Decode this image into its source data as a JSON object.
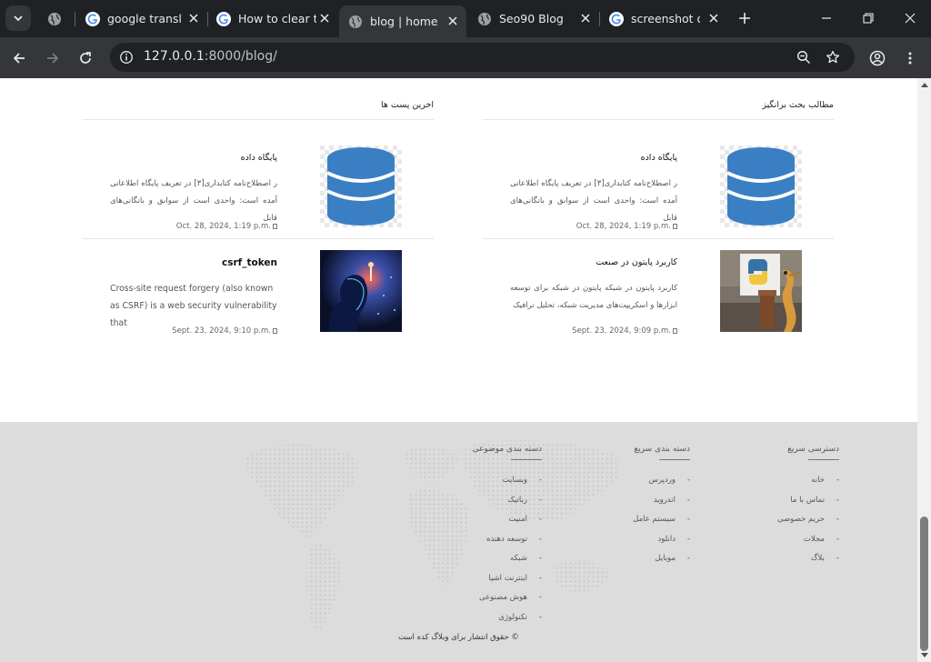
{
  "browser": {
    "tabs": [
      {
        "title": "",
        "favicon": "globe-icon"
      },
      {
        "title": "google transl",
        "favicon": "google-icon"
      },
      {
        "title": "How to clear t",
        "favicon": "google-icon"
      },
      {
        "title": "blog | home",
        "favicon": "globe-icon",
        "active": true
      },
      {
        "title": "Seo90 Blog",
        "favicon": "globe-icon"
      },
      {
        "title": "screenshot or",
        "favicon": "google-icon"
      }
    ],
    "url_host": "127.0.0.1",
    "url_rest": ":8000/blog/"
  },
  "page": {
    "right_column": {
      "title": "مطالب بحث برانگیز",
      "posts": [
        {
          "title": "پایگاه داده",
          "excerpt": "ر اصطلاح‌نامه کتابداری[۳] در تعریف پایگاه اطلاعاتی آمده است: واحدی است از سوابق و بانگانی‌های قابل",
          "date": "Oct. 28, 2024, 1:19 p.m.",
          "image": "database-icon"
        },
        {
          "title": "کاربرد پایتون در صنعت",
          "excerpt": "کاربرد پایتون در شبکه پایتون در شبکه برای توسعه ابزارها و اسکریپت‌های مدیریت شبکه، تحلیل ترافیک",
          "date": "Sept. 23, 2024, 9:09 p.m.",
          "image": "python-snake-illustration"
        }
      ]
    },
    "left_column": {
      "title": "اخرین پست ها",
      "posts": [
        {
          "title": "پایگاه داده",
          "excerpt": "ر اصطلاح‌نامه کتابداری[۳] در تعریف پایگاه اطلاعاتی آمده است: واحدی است از سوابق و بانگانی‌های قابل",
          "date": "Oct. 28, 2024, 1:19 p.m.",
          "image": "database-icon"
        },
        {
          "title": "csrf_token",
          "excerpt": "Cross-site request forgery (also known as CSRF) is a web security vulnerability that",
          "date": "Sept. 23, 2024, 9:10 p.m.",
          "image": "cyber-face-illustration"
        }
      ]
    }
  },
  "footer": {
    "quick_access": {
      "title": "دسترسی سریع",
      "items": [
        "خانه",
        "تماس با ما",
        "حریم خصوصی",
        "مجلات",
        "بلاگ"
      ]
    },
    "quick_categories": {
      "title": "دسته بندی سریع",
      "items": [
        "وردپرس",
        "اندروید",
        "سیستم عامل",
        "دانلود",
        "موبایل"
      ]
    },
    "topic_categories": {
      "title": "دسته بندی موضوعی",
      "items": [
        "وبسایت",
        "رباتیک",
        "امنیت",
        "توسعه دهنده",
        "شبکه",
        "اینترنت اشیا",
        "هوش مصنوعی",
        "تکنولوژی"
      ]
    },
    "copyright": "© حقوق انتشار برای وبلاگ کده است"
  }
}
